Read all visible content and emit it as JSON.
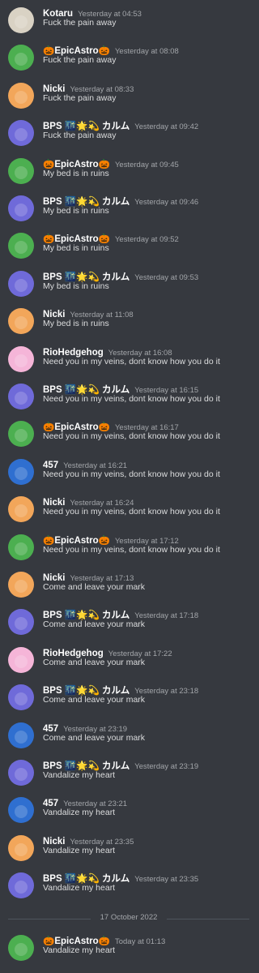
{
  "users": {
    "kotaru": {
      "name": "Kotaru",
      "avatar_color": "#d9d2c4"
    },
    "epic": {
      "name": "🎃EpicAstro🎃",
      "avatar_color": "#4caf50"
    },
    "nicki": {
      "name": "Nicki",
      "avatar_color": "#f2a65a"
    },
    "bps": {
      "name": "BPS 🌃🌟💫 カルム",
      "avatar_color": "#6f6ad9"
    },
    "rio": {
      "name": "RioHedgehog",
      "avatar_color": "#f5b5d8"
    },
    "457": {
      "name": "457",
      "avatar_color": "#2f6fd0"
    }
  },
  "messages": [
    {
      "user": "kotaru",
      "author": "Kotaru",
      "time": "Yesterday at 04:53",
      "text": "Fuck the pain away"
    },
    {
      "user": "epic",
      "author": "🎃EpicAstro🎃",
      "time": "Yesterday at 08:08",
      "text": "Fuck the pain away"
    },
    {
      "user": "nicki",
      "author": "Nicki",
      "time": "Yesterday at 08:33",
      "text": "Fuck the pain away"
    },
    {
      "user": "bps",
      "author": "BPS 🌃🌟💫 カルム",
      "time": "Yesterday at 09:42",
      "text": "Fuck the pain away"
    },
    {
      "user": "epic",
      "author": "🎃EpicAstro🎃",
      "time": "Yesterday at 09:45",
      "text": "My bed is in ruins"
    },
    {
      "user": "bps",
      "author": "BPS 🌃🌟💫 カルム",
      "time": "Yesterday at 09:46",
      "text": "My bed is in ruins"
    },
    {
      "user": "epic",
      "author": "🎃EpicAstro🎃",
      "time": "Yesterday at 09:52",
      "text": "My bed is in ruins"
    },
    {
      "user": "bps",
      "author": "BPS 🌃🌟💫 カルム",
      "time": "Yesterday at 09:53",
      "text": "My bed is in ruins"
    },
    {
      "user": "nicki",
      "author": "Nicki",
      "time": "Yesterday at 11:08",
      "text": "My bed is in ruins"
    },
    {
      "user": "rio",
      "author": "RioHedgehog",
      "time": "Yesterday at 16:08",
      "text": "Need you in my veins, dont know how you do it"
    },
    {
      "user": "bps",
      "author": "BPS 🌃🌟💫 カルム",
      "time": "Yesterday at 16:15",
      "text": "Need you in my veins, dont know how you do it"
    },
    {
      "user": "epic",
      "author": "🎃EpicAstro🎃",
      "time": "Yesterday at 16:17",
      "text": "Need you in my veins, dont know how you do it"
    },
    {
      "user": "457",
      "author": "457",
      "time": "Yesterday at 16:21",
      "text": "Need you in my veins, dont know how you do it"
    },
    {
      "user": "nicki",
      "author": "Nicki",
      "time": "Yesterday at 16:24",
      "text": "Need you in my veins, dont know how you do it"
    },
    {
      "user": "epic",
      "author": "🎃EpicAstro🎃",
      "time": "Yesterday at 17:12",
      "text": "Need you in my veins, dont know how you do it"
    },
    {
      "user": "nicki",
      "author": "Nicki",
      "time": "Yesterday at 17:13",
      "text": "Come and leave your mark"
    },
    {
      "user": "bps",
      "author": "BPS 🌃🌟💫 カルム",
      "time": "Yesterday at 17:18",
      "text": "Come and leave your mark"
    },
    {
      "user": "rio",
      "author": "RioHedgehog",
      "time": "Yesterday at 17:22",
      "text": "Come and leave your mark"
    },
    {
      "user": "bps",
      "author": "BPS 🌃🌟💫 カルム",
      "time": "Yesterday at 23:18",
      "text": "Come and leave your mark"
    },
    {
      "user": "457",
      "author": "457",
      "time": "Yesterday at 23:19",
      "text": "Come and leave your mark"
    },
    {
      "user": "bps",
      "author": "BPS 🌃🌟💫 カルム",
      "time": "Yesterday at 23:19",
      "text": "Vandalize my heart"
    },
    {
      "user": "457",
      "author": "457",
      "time": "Yesterday at 23:21",
      "text": "Vandalize my heart"
    },
    {
      "user": "nicki",
      "author": "Nicki",
      "time": "Yesterday at 23:35",
      "text": "Vandalize my heart"
    },
    {
      "user": "bps",
      "author": "BPS 🌃🌟💫 カルム",
      "time": "Yesterday at 23:35",
      "text": "Vandalize my heart"
    },
    {
      "user": "epic",
      "author": "🎃EpicAstro🎃",
      "time": "Today at 01:13",
      "text": "Vandalize my heart"
    }
  ],
  "date_divider": {
    "label": "17 October 2022"
  }
}
